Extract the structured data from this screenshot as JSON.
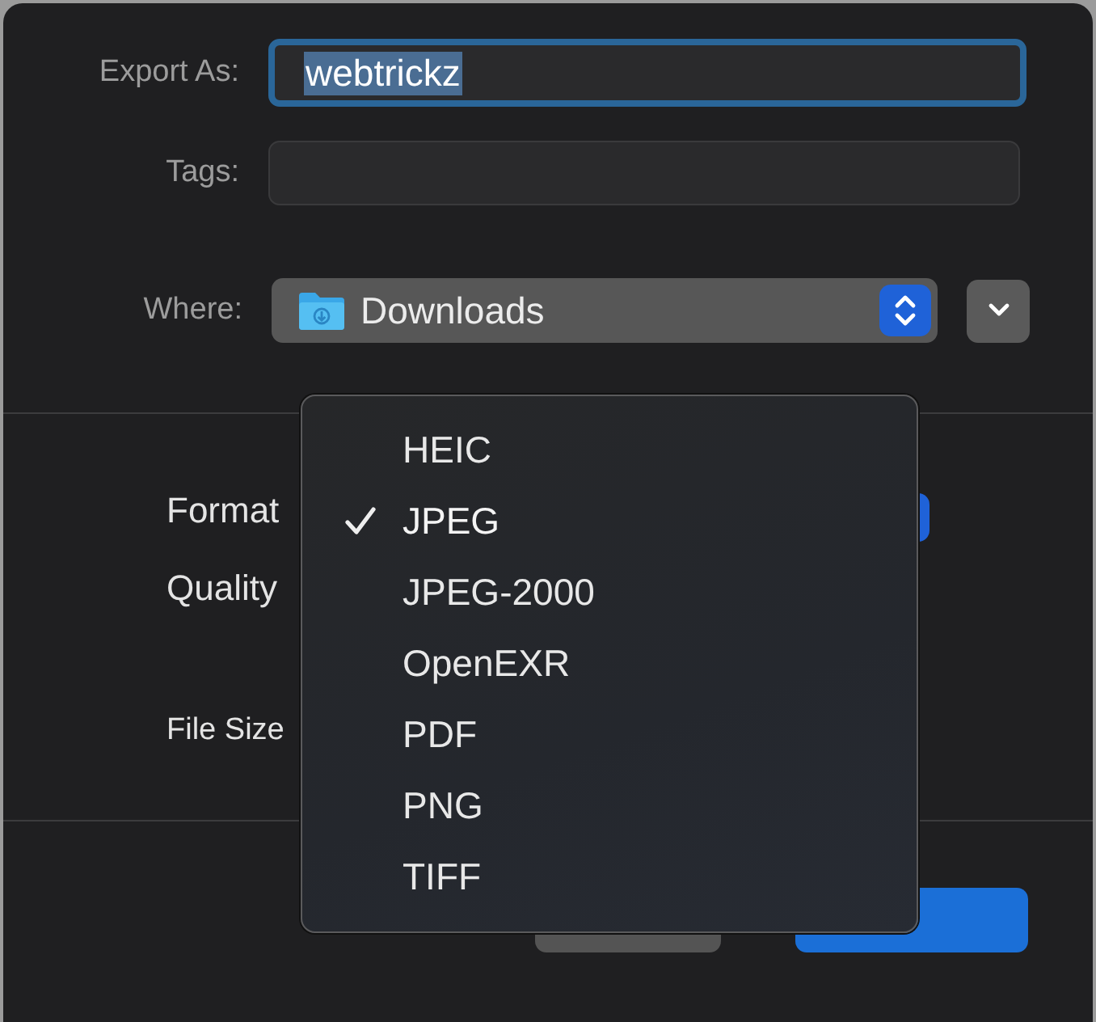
{
  "export_as": {
    "label": "Export As:",
    "value": "webtrickz",
    "focused": true
  },
  "tags": {
    "label": "Tags:"
  },
  "where": {
    "label": "Where:",
    "value": "Downloads"
  },
  "options": [
    {
      "label": "Format"
    },
    {
      "label": "Quality"
    },
    {
      "label": "File Size"
    }
  ],
  "buttons": [
    {
      "kind": "secondary"
    },
    {
      "kind": "primary"
    }
  ],
  "format_menu": {
    "items": [
      {
        "label": "HEIC",
        "selected": false
      },
      {
        "label": "JPEG",
        "selected": true
      },
      {
        "label": "JPEG-2000",
        "selected": false
      },
      {
        "label": "OpenEXR",
        "selected": false
      },
      {
        "label": "PDF",
        "selected": false
      },
      {
        "label": "PNG",
        "selected": false
      },
      {
        "label": "TIFF",
        "selected": false
      }
    ]
  }
}
